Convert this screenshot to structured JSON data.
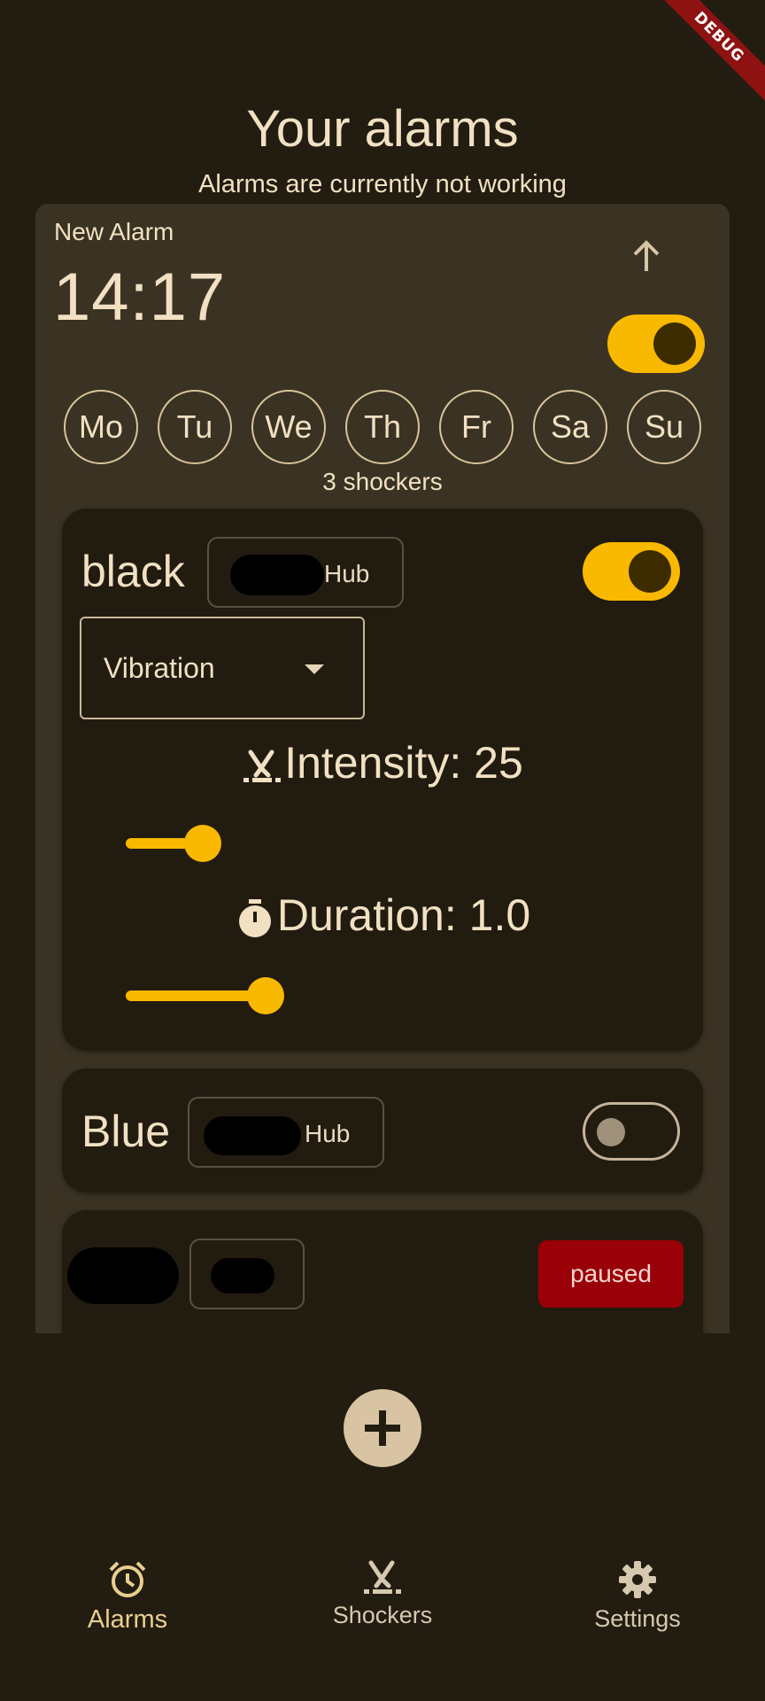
{
  "debug_banner": "DEBUG",
  "header": {
    "title": "Your alarms",
    "status": "Alarms are currently not working"
  },
  "alarm": {
    "name": "New Alarm",
    "time": "14:17",
    "enabled": true,
    "days": [
      "Mo",
      "Tu",
      "We",
      "Th",
      "Fr",
      "Sa",
      "Su"
    ],
    "shocker_count": "3 shockers",
    "shockers": [
      {
        "name": "black",
        "hub_label": "Hub",
        "enabled": true,
        "mode": "Vibration",
        "intensity_label": "Intensity: 25",
        "intensity_value": 25,
        "duration_label": "Duration: 1.0",
        "duration_value": 1.0
      },
      {
        "name": "Blue",
        "hub_label": "Hub",
        "enabled": false
      },
      {
        "name": "",
        "hub_label": "",
        "status": "paused"
      }
    ]
  },
  "bottom_nav": {
    "items": [
      {
        "label": "Alarms",
        "icon": "alarm-clock-icon",
        "active": true
      },
      {
        "label": "Shockers",
        "icon": "shocker-icon",
        "active": false
      },
      {
        "label": "Settings",
        "icon": "gear-icon",
        "active": false
      }
    ]
  },
  "colors": {
    "background": "#221c11",
    "card": "#3a3223",
    "accent": "#f9b900",
    "paused": "#9a0008"
  }
}
